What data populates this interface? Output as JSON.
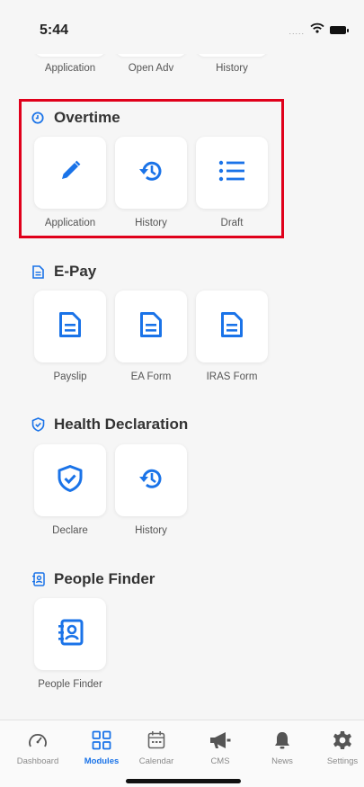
{
  "status": {
    "time": "5:44",
    "dots": "....."
  },
  "top_row": {
    "labels": [
      "Application",
      "Open Adv",
      "History"
    ]
  },
  "sections": {
    "overtime": {
      "title": "Overtime",
      "items": [
        {
          "label": "Application",
          "icon": "pencil-icon"
        },
        {
          "label": "History",
          "icon": "history-icon"
        },
        {
          "label": "Draft",
          "icon": "list-icon"
        }
      ]
    },
    "epay": {
      "title": "E-Pay",
      "items": [
        {
          "label": "Payslip",
          "icon": "document-icon"
        },
        {
          "label": "EA Form",
          "icon": "document-icon"
        },
        {
          "label": "IRAS Form",
          "icon": "document-icon"
        }
      ]
    },
    "health": {
      "title": "Health Declaration",
      "items": [
        {
          "label": "Declare",
          "icon": "shield-check-icon"
        },
        {
          "label": "History",
          "icon": "history-icon"
        }
      ]
    },
    "people": {
      "title": "People Finder",
      "items": [
        {
          "label": "People Finder",
          "icon": "contact-book-icon"
        }
      ]
    }
  },
  "tabbar": {
    "items": [
      {
        "label": "Dashboard",
        "icon": "gauge-icon"
      },
      {
        "label": "Modules",
        "icon": "grid-icon",
        "active": true
      },
      {
        "label": "Calendar",
        "icon": "calendar-icon"
      },
      {
        "label": "CMS",
        "icon": "megaphone-icon"
      },
      {
        "label": "News",
        "icon": "bell-icon"
      },
      {
        "label": "Settings",
        "icon": "gear-icon"
      }
    ]
  },
  "colors": {
    "accent": "#1a73e8",
    "highlight": "#e0001b",
    "background": "#f6f6f6"
  }
}
